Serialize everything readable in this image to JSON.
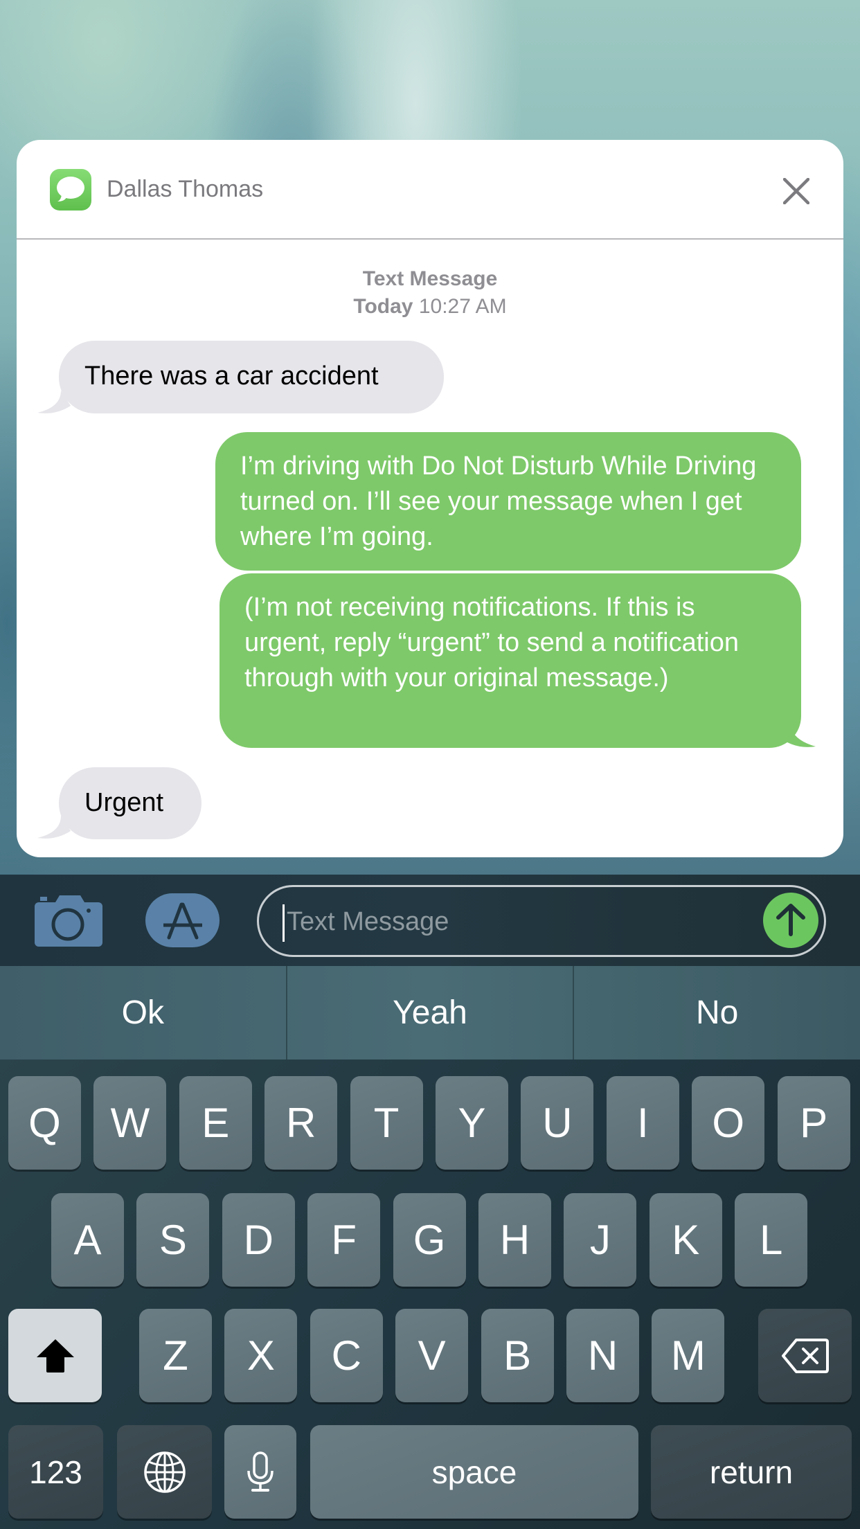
{
  "notification": {
    "app_icon": "messages-icon",
    "sender": "Dallas Thomas",
    "close_icon": "close-icon",
    "kind": "Text Message",
    "day": "Today",
    "time": "10:27 AM"
  },
  "messages": [
    {
      "direction": "incoming",
      "text": "There was a car accident"
    },
    {
      "direction": "outgoing",
      "text": "I’m driving with Do Not Disturb While Driving turned on. I’ll see your message when I get where I’m going."
    },
    {
      "direction": "outgoing",
      "text": "(I’m not receiving notifications. If this is urgent, reply “urgent” to send a notification through with your original message.)"
    },
    {
      "direction": "incoming",
      "text": "Urgent"
    }
  ],
  "composer": {
    "camera_icon": "camera-icon",
    "apps_icon": "app-store-icon",
    "placeholder": "Text Message",
    "value": "",
    "send_icon": "arrow-up-icon"
  },
  "predictive": [
    "Ok",
    "Yeah",
    "No"
  ],
  "keyboard": {
    "row1": [
      "Q",
      "W",
      "E",
      "R",
      "T",
      "Y",
      "U",
      "I",
      "O",
      "P"
    ],
    "row2": [
      "A",
      "S",
      "D",
      "F",
      "G",
      "H",
      "J",
      "K",
      "L"
    ],
    "row3": [
      "Z",
      "X",
      "C",
      "V",
      "B",
      "N",
      "M"
    ],
    "shift_icon": "shift-icon",
    "delete_icon": "delete-icon",
    "numbers_label": "123",
    "globe_icon": "globe-icon",
    "mic_icon": "microphone-icon",
    "space_label": "space",
    "return_label": "return"
  },
  "colors": {
    "outgoing_bubble": "#7ec96a",
    "incoming_bubble": "#e5e5ea",
    "send_button": "#6cc660",
    "app_button": "#5a82a8"
  }
}
